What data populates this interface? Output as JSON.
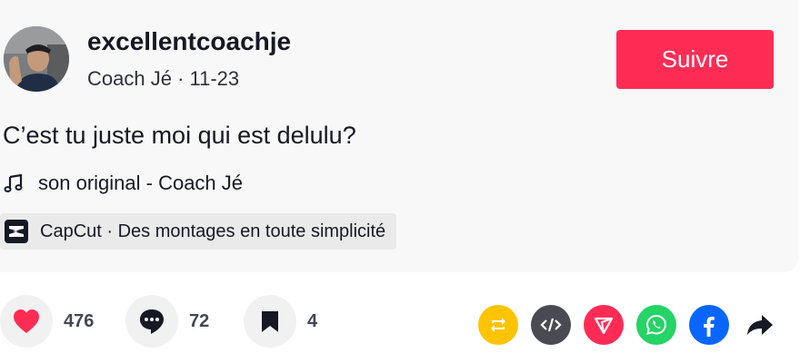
{
  "author": {
    "username": "excellentcoachje",
    "display_name": "Coach Jé",
    "separator": " · ",
    "date": "11-23"
  },
  "follow_label": "Suivre",
  "caption": "C’est tu juste moi qui est delulu?",
  "music": "son original - Coach Jé",
  "capcut": "CapCut · Des montages en toute simplicité",
  "stats": {
    "likes": "476",
    "comments": "72",
    "saves": "4"
  },
  "colors": {
    "accent": "#fe2c55",
    "like": "#fe2c55",
    "repost": "#ffc300",
    "embed": "#4a4b52",
    "send": "#fe2c55",
    "whatsapp": "#25d366",
    "facebook": "#0866ff"
  },
  "icons": [
    "music-note-icon",
    "capcut-icon",
    "heart-icon",
    "comment-icon",
    "bookmark-icon",
    "repost-icon",
    "embed-icon",
    "send-icon",
    "whatsapp-icon",
    "facebook-icon",
    "share-arrow-icon"
  ]
}
